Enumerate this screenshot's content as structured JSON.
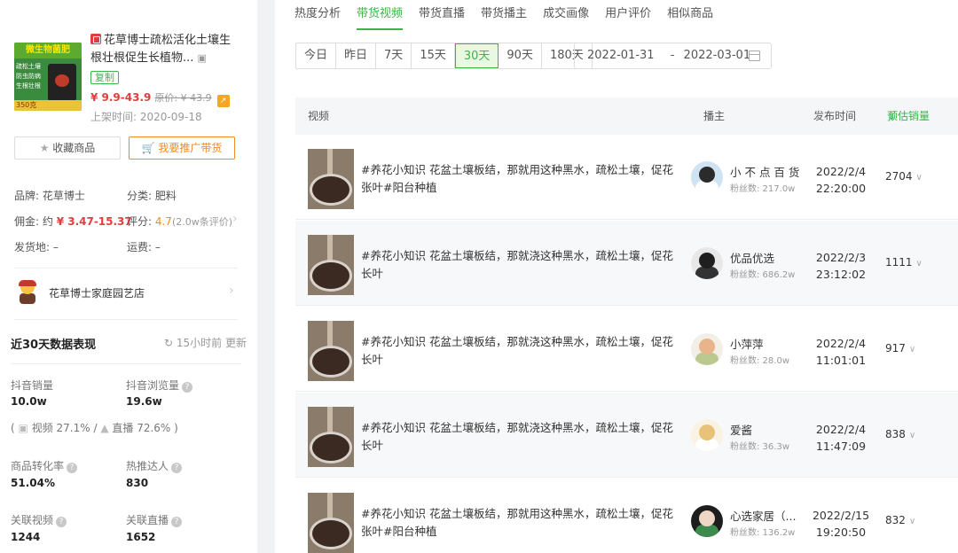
{
  "product": {
    "image_text": "微生物菌肥",
    "image_tags": "疏松土壤 防虫防病 生根壮根",
    "image_price": "350克",
    "title": "花草博士疏松活化土壤生根壮根促生长植物...",
    "title_icon_suffix": "▣",
    "copy_label": "复制",
    "price": "¥ 9.9-43.9",
    "orig_label": "原价: ¥ 43.9",
    "listed": "上架时间: 2020-09-18",
    "fav_label": "收藏商品",
    "promo_label": "我要推广带货",
    "brand": "品牌: 花草博士",
    "category": "分类: 肥料",
    "commission_label": "佣金: 约 ",
    "commission": "¥ 3.47-15.37",
    "rating_label": "评分: ",
    "rating": "4.7",
    "rating_count": "(2.0w条评价)",
    "ship_from": "发货地: –",
    "freight": "运费: –",
    "shop_name": "花草博士家庭园艺店"
  },
  "stats": {
    "title": "近30天数据表现",
    "updated": "15小时前 更新",
    "items": [
      {
        "label": "抖音销量",
        "value": "10.0w"
      },
      {
        "label": "抖音浏览量",
        "value": "19.6w"
      },
      {
        "label": "商品转化率",
        "value": "51.04%"
      },
      {
        "label": "热推达人",
        "value": "830"
      },
      {
        "label": "关联视频",
        "value": "1244"
      },
      {
        "label": "关联直播",
        "value": "1652"
      }
    ],
    "share_video": "视频 27.1% /",
    "share_live": "直播 72.6% )",
    "share_open": "("
  },
  "tabs": [
    "热度分析",
    "带货视频",
    "带货直播",
    "带货播主",
    "成交画像",
    "用户评价",
    "相似商品"
  ],
  "active_tab": 1,
  "ranges": [
    "今日",
    "昨日",
    "7天",
    "15天",
    "30天",
    "90天",
    "180天"
  ],
  "active_range": 4,
  "date_start": "2022-01-31",
  "date_sep": "-",
  "date_end": "2022-03-01",
  "table": {
    "col_video": "视频",
    "col_anchor": "播主",
    "col_pub": "发布时间",
    "col_sales": "预估销量",
    "rows": [
      {
        "title": "#养花小知识 花盆土壤板结，那就用这种黑水，疏松土壤，促花张叶#阳台种植",
        "anchor": "小 不 点 百 货",
        "fans": "粉丝数: 217.0w",
        "date": "2022/2/4",
        "time": "22:20:00",
        "sales": "2704"
      },
      {
        "title": "#养花小知识 花盆土壤板结，那就浇这种黑水，疏松土壤，促花长叶",
        "anchor": "优品优选",
        "fans": "粉丝数: 686.2w",
        "date": "2022/2/3",
        "time": "23:12:02",
        "sales": "1111"
      },
      {
        "title": "#养花小知识 花盆土壤板结，那就浇这种黑水，疏松土壤，促花长叶",
        "anchor": "小萍萍",
        "fans": "粉丝数: 28.0w",
        "date": "2022/2/4",
        "time": "11:01:01",
        "sales": "917"
      },
      {
        "title": "#养花小知识 花盆土壤板结，那就浇这种黑水，疏松土壤，促花长叶",
        "anchor": "爱酱",
        "fans": "粉丝数: 36.3w",
        "date": "2022/2/4",
        "time": "11:47:09",
        "sales": "838"
      },
      {
        "title": "#养花小知识 花盆土壤板结，那就用这种黑水，疏松土壤，促花张叶#阳台种植",
        "anchor": "心选家居（...",
        "fans": "粉丝数: 136.2w",
        "date": "2022/2/15",
        "time": "19:20:50",
        "sales": "832"
      }
    ]
  }
}
